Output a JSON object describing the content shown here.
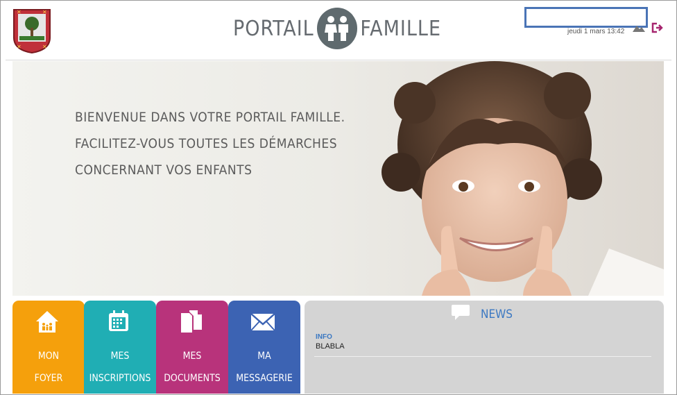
{
  "header": {
    "brand_left": "PORTAIL",
    "brand_right": "FAMILLE",
    "datetime": "jeudi 1 mars 13:42",
    "logout_icon": "logout-icon",
    "account_icon": "mountain-icon"
  },
  "hero": {
    "line1": "Bienvenue dans votre portail famille.",
    "line2": "Facilitez-vous toutes les démarches",
    "line3": "concernant vos enfants"
  },
  "tiles": [
    {
      "line1": "MON",
      "line2": "FOYER",
      "icon": "house-icon",
      "color": "#f5a00c"
    },
    {
      "line1": "MES",
      "line2": "INSCRIPTIONS",
      "icon": "calendar-icon",
      "color": "#20aeb4"
    },
    {
      "line1": "MES",
      "line2": "DOCUMENTS",
      "icon": "documents-icon",
      "color": "#b8337b"
    },
    {
      "line1": "MA",
      "line2": "MESSAGERIE",
      "icon": "envelope-icon",
      "color": "#3c63b3"
    }
  ],
  "news": {
    "title": "NEWS",
    "items": [
      {
        "title": "INFO",
        "body": "BLABLA"
      }
    ]
  },
  "colors": {
    "accent_blue": "#3b78c2",
    "logout": "#a6246e"
  }
}
